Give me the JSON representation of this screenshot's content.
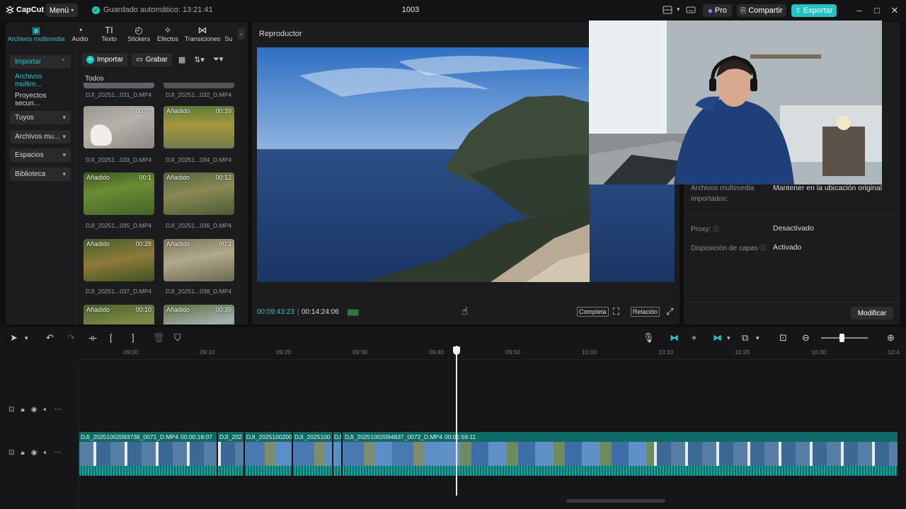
{
  "titlebar": {
    "logo": "CapCut",
    "menu_label": "Menú",
    "autosave": "Guardado automático: 13:21:41",
    "project_name": "1003",
    "pro_label": "Pro",
    "share_label": "Compartir",
    "export_label": "Exportar"
  },
  "media_tabs": [
    {
      "label": "Archivos multimedia",
      "icon": "media-icon"
    },
    {
      "label": "Audio",
      "icon": "audio-icon"
    },
    {
      "label": "Texto",
      "icon": "text-icon"
    },
    {
      "label": "Stickers",
      "icon": "sticker-icon"
    },
    {
      "label": "Efectos",
      "icon": "effects-icon"
    },
    {
      "label": "Transiciones",
      "icon": "transitions-icon"
    },
    {
      "label": "Su",
      "icon": "subtitles-icon"
    }
  ],
  "sidebar": {
    "items": [
      {
        "label": "Importar"
      },
      {
        "label": "Archivos multim..."
      },
      {
        "label": "Proyectos secun..."
      },
      {
        "label": "Tuyos"
      },
      {
        "label": "Archivos mu..."
      },
      {
        "label": "Espacios"
      },
      {
        "label": "Biblioteca"
      }
    ]
  },
  "media_toolbar": {
    "import_label": "Importar",
    "record_label": "Grabar",
    "filter_label": "Todos"
  },
  "media_items": [
    {
      "name": "DJI_20251...031_D.MP4",
      "duration": "",
      "added": ""
    },
    {
      "name": "DJI_20251...032_D.MP4",
      "duration": "",
      "added": ""
    },
    {
      "name": "DJI_20251...033_D.MP4",
      "duration": "00:07",
      "added": ""
    },
    {
      "name": "DJI_20251...034_D.MP4",
      "duration": "00:39",
      "added": "Añadido"
    },
    {
      "name": "DJI_20251...035_D.MP4",
      "duration": "00:1",
      "added": "Añadido"
    },
    {
      "name": "DJI_20251...036_D.MP4",
      "duration": "00:12",
      "added": "Añadido"
    },
    {
      "name": "DJI_20251...037_D.MP4",
      "duration": "00:28",
      "added": "Añadido"
    },
    {
      "name": "DJI_20251...038_D.MP4",
      "duration": "00:2",
      "added": "Añadido"
    },
    {
      "name": "",
      "duration": "00:10",
      "added": "Añadido"
    },
    {
      "name": "",
      "duration": "00:39",
      "added": "Añadido"
    }
  ],
  "player": {
    "title": "Reproductor",
    "current_time": "00:09:43:23",
    "total_time": "00:14:24:06",
    "complete_label": "Completa",
    "ratio_label": "Relación"
  },
  "details": {
    "rows": [
      {
        "label": "Archivos multimedia importados:",
        "value": "Mantener en la ubicación original"
      },
      {
        "label": "Proxy:",
        "value": "Desactivado"
      },
      {
        "label": "Disposición de capas",
        "value": "Activado"
      }
    ],
    "modify_label": "Modificar"
  },
  "timeline": {
    "ticks": [
      "09:00",
      "09:10",
      "09:20",
      "09:30",
      "09:40",
      "09:50",
      "10:00",
      "10:10",
      "10:20",
      "10:30",
      "10:4"
    ],
    "clips": [
      {
        "label": "DJI_20251002093738_0071_D.MP4",
        "duration": "00:00:18:07"
      },
      {
        "label": "DJI_202",
        "duration": ""
      },
      {
        "label": "DJI_2025100200",
        "duration": ""
      },
      {
        "label": "DJI_2025100",
        "duration": ""
      },
      {
        "label": "DJ",
        "duration": ""
      },
      {
        "label": "DJI_20251002094837_0072_D.MP4",
        "duration": "00:01:56:11"
      }
    ]
  },
  "colors": {
    "accent": "#23c3c4",
    "clip": "#0f6a66",
    "panel": "#1c1c1e",
    "background": "#0f0f10"
  }
}
